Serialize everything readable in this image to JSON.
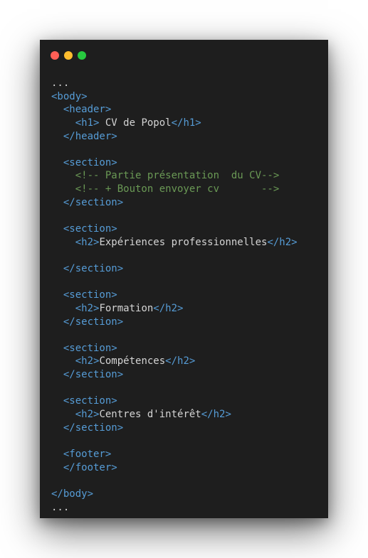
{
  "window": {
    "controls": [
      {
        "name": "close-control",
        "color": "#ff5f56"
      },
      {
        "name": "minimize-control",
        "color": "#ffbd2e"
      },
      {
        "name": "maximize-control",
        "color": "#27c93f"
      }
    ]
  },
  "colors": {
    "tag": "#569cd6",
    "text": "#d4d4d4",
    "comment": "#6a9955"
  },
  "code_lines": [
    [
      {
        "t": "...",
        "c": "text"
      }
    ],
    [
      {
        "t": "<body>",
        "c": "tag"
      }
    ],
    [
      {
        "t": "  <header>",
        "c": "tag"
      }
    ],
    [
      {
        "t": "    <h1>",
        "c": "tag"
      },
      {
        "t": " CV de Popol",
        "c": "text"
      },
      {
        "t": "</h1>",
        "c": "tag"
      }
    ],
    [
      {
        "t": "  </header>",
        "c": "tag"
      }
    ],
    [],
    [
      {
        "t": "  <section>",
        "c": "tag"
      }
    ],
    [
      {
        "t": "    <!-- Partie présentation  du CV-->",
        "c": "comment"
      }
    ],
    [
      {
        "t": "    <!-- + Bouton envoyer cv       -->",
        "c": "comment"
      }
    ],
    [
      {
        "t": "  </section>",
        "c": "tag"
      }
    ],
    [],
    [
      {
        "t": "  <section>",
        "c": "tag"
      }
    ],
    [
      {
        "t": "    <h2>",
        "c": "tag"
      },
      {
        "t": "Expériences professionnelles",
        "c": "text"
      },
      {
        "t": "</h2>",
        "c": "tag"
      }
    ],
    [],
    [
      {
        "t": "  </section>",
        "c": "tag"
      }
    ],
    [],
    [
      {
        "t": "  <section>",
        "c": "tag"
      }
    ],
    [
      {
        "t": "    <h2>",
        "c": "tag"
      },
      {
        "t": "Formation",
        "c": "text"
      },
      {
        "t": "</h2>",
        "c": "tag"
      }
    ],
    [
      {
        "t": "  </section>",
        "c": "tag"
      }
    ],
    [],
    [
      {
        "t": "  <section>",
        "c": "tag"
      }
    ],
    [
      {
        "t": "    <h2>",
        "c": "tag"
      },
      {
        "t": "Compétences",
        "c": "text"
      },
      {
        "t": "</h2>",
        "c": "tag"
      }
    ],
    [
      {
        "t": "  </section>",
        "c": "tag"
      }
    ],
    [],
    [
      {
        "t": "  <section>",
        "c": "tag"
      }
    ],
    [
      {
        "t": "    <h2>",
        "c": "tag"
      },
      {
        "t": "Centres d'intérêt",
        "c": "text"
      },
      {
        "t": "</h2>",
        "c": "tag"
      }
    ],
    [
      {
        "t": "  </section>",
        "c": "tag"
      }
    ],
    [],
    [
      {
        "t": "  <footer>",
        "c": "tag"
      }
    ],
    [
      {
        "t": "  </footer>",
        "c": "tag"
      }
    ],
    [],
    [
      {
        "t": "</body>",
        "c": "tag"
      }
    ],
    [
      {
        "t": "...",
        "c": "text"
      }
    ]
  ]
}
